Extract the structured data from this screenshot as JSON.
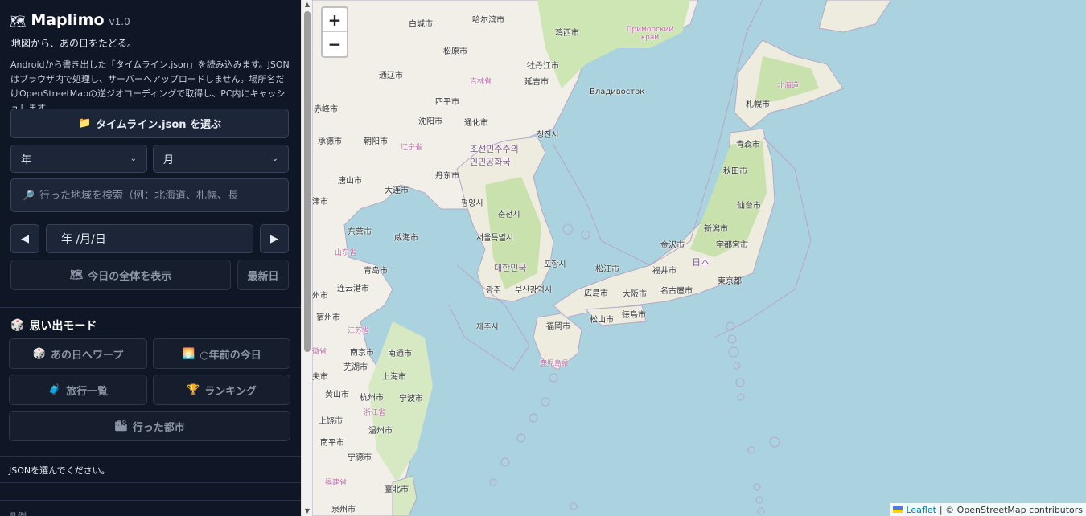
{
  "app": {
    "logo_icon": "world-map-icon",
    "name": "Maplimo",
    "version": "v1.0",
    "tagline": "地図から、あの日をたどる。",
    "description": "Androidから書き出した「タイムライン.json」を読み込みます。JSONはブラウザ内で処理し、サーバーへアップロードしません。場所名だけOpenStreetMapの逆ジオコーディングで取得し、PC内にキャッシュします。"
  },
  "controls": {
    "choose_file_label": "タイムライン.json を選ぶ",
    "year_select": "年",
    "month_select": "月",
    "search_placeholder": "行った地域を検索（例：北海道、札幌、長",
    "prev_day": "◀",
    "next_day": "▶",
    "date_value": "年 /月/日",
    "show_all_today": "今日の全体を表示",
    "latest_day": "最新日"
  },
  "memory_mode": {
    "title": "思い出モード",
    "warp": "あの日へワープ",
    "years_ago": "○年前の今日",
    "trip_list": "旅行一覧",
    "ranking": "ランキング",
    "visited_cities": "行った都市"
  },
  "status": {
    "message": "JSONを選んでください。",
    "footer": "凡例"
  },
  "map": {
    "zoom_in": "+",
    "zoom_out": "−",
    "attribution_leaflet": "Leaflet",
    "attribution_osm": "| © OpenStreetMap contributors",
    "labels": {
      "harbin": "哈尔滨市",
      "baicheng": "白城市",
      "jixi": "鸡西市",
      "primorsky": "Приморский край",
      "songyuan": "松原市",
      "mudanjiang": "牡丹江市",
      "tongliao": "通辽市",
      "jilin": "吉林省",
      "yanji": "延吉市",
      "vladivostok": "Владивосток",
      "hokkaido": "北海道",
      "sapporo": "札幌市",
      "chifeng": "赤峰市",
      "siping": "四平市",
      "shenyang": "沈阳市",
      "tonghua": "通化市",
      "chongjin": "청진시",
      "chengde": "承德市",
      "chaoyang": "朝阳市",
      "liaoning": "辽宁省",
      "nk": "조선민주주의인민공화국",
      "aomori": "青森市",
      "akita": "秋田市",
      "tangshan": "唐山市",
      "dandong": "丹东市",
      "dalian": "大连市",
      "pyongyang": "평양시",
      "sendai": "仙台市",
      "tianjin": "津市",
      "chuncheon": "춘천시",
      "niigata": "新潟市",
      "dongying": "东营市",
      "weihai": "威海市",
      "seoul": "서울특별시",
      "kanazawa": "金沢市",
      "utsunomiya": "宇都宮市",
      "shandong": "山东省",
      "qingdao": "青岛市",
      "korea": "대한민국",
      "pohang": "포항시",
      "matsue": "松江市",
      "fukui": "福井市",
      "japan": "日本",
      "tokyo": "東京都",
      "lianyungang": "连云港市",
      "gwangju": "광주",
      "busan": "부산광역시",
      "hiroshima": "広島市",
      "osaka": "大阪市",
      "nagoya": "名古屋市",
      "suqian": "宿州市",
      "matsuyama": "松山市",
      "tokushima": "徳島市",
      "jiangsu": "江苏省",
      "jeju": "제주시",
      "fukuoka": "福岡市",
      "nanjing": "南京市",
      "nantong": "南通市",
      "anhui": "徽省",
      "kagoshima": "鹿児島県",
      "wuhu": "芜湖市",
      "shanghai": "上海市",
      "hefei": "夫市",
      "huangshan": "黄山市",
      "hangzhou": "杭州市",
      "ningbo": "宁波市",
      "zhejiang": "浙江省",
      "shangrao": "上饶市",
      "wenzhou": "温州市",
      "nanping": "南平市",
      "ningde": "宁德市",
      "fujian": "福建省",
      "taipei": "臺北市",
      "quanzhou": "泉州市",
      "xuzhou": "州市"
    }
  }
}
